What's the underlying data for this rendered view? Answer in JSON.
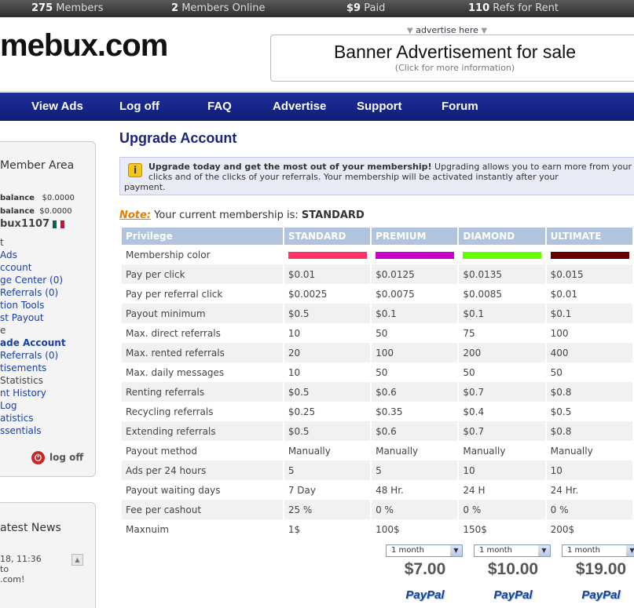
{
  "stats": {
    "members_count": "275",
    "members_label": "Members",
    "online_count": "2",
    "online_label": "Members Online",
    "paid_count": "$9",
    "paid_label": "Paid",
    "refs_count": "110",
    "refs_label": "Refs for Rent"
  },
  "header": {
    "logo": "mebux.com",
    "advertise_link": "advertise here",
    "banner_title": "Banner Advertisement for sale",
    "banner_sub": "(Click for more information)"
  },
  "nav": [
    "View Ads",
    "Log off",
    "FAQ",
    "Advertise",
    "Support",
    "Forum"
  ],
  "sidebar": {
    "title": "Member Area",
    "balance_label": "balance",
    "balance_value": "$0.0000",
    "balance2_label": "balance",
    "balance2_value": "$0.0000",
    "username": "bux1107",
    "items": [
      {
        "label": "t",
        "kind": "plain"
      },
      {
        "label": "Ads",
        "kind": "link"
      },
      {
        "label": "ccount",
        "kind": "link"
      },
      {
        "label": "ge Center (0)",
        "kind": "link"
      },
      {
        "label": " Referrals (0)",
        "kind": "link"
      },
      {
        "label": "tion Tools",
        "kind": "link"
      },
      {
        "label": "st Payout",
        "kind": "link"
      },
      {
        "label": "e",
        "kind": "plain"
      },
      {
        "label": "ade Account",
        "kind": "active"
      },
      {
        "label": "Referrals (0)",
        "kind": "link"
      },
      {
        "label": "tisements",
        "kind": "link"
      },
      {
        "label": " Statistics",
        "kind": "plain"
      },
      {
        "label": "nt History",
        "kind": "link"
      },
      {
        "label": "Log",
        "kind": "link"
      },
      {
        "label": "atistics",
        "kind": "link"
      },
      {
        "label": "ssentials",
        "kind": "link"
      }
    ],
    "logoff": "log off"
  },
  "news": {
    "title": "atest News",
    "date": "18, 11:36",
    "line1": "to",
    "line2": ".com!"
  },
  "main": {
    "title": "Upgrade Account",
    "info_bold": "Upgrade today and get the most out of your membership!",
    "info_text": " Upgrading allows you to earn more from your clicks and of the clicks of your referrals. Your membership will be activated instantly after your",
    "info_cont": "payment.",
    "note_label": "Note:",
    "note_text": " Your current membership is: ",
    "note_value": "STANDARD"
  },
  "table": {
    "headers": [
      "Privilege",
      "STANDARD",
      "PREMIUM",
      "DIAMOND",
      "ULTIMATE"
    ],
    "color_label": "Membership color",
    "colors": [
      "#ff3366",
      "#cc00cc",
      "#66ff00",
      "#660000"
    ],
    "rows": [
      [
        "Pay per click",
        "$0.01",
        "$0.0125",
        "$0.0135",
        "$0.015"
      ],
      [
        "Pay per referral click",
        "$0.0025",
        "$0.0075",
        "$0.0085",
        "$0.01"
      ],
      [
        "Payout minimum",
        "$0.5",
        "$0.1",
        "$0.1",
        "$0.1"
      ],
      [
        "Max. direct referrals",
        "10",
        "50",
        "75",
        "100"
      ],
      [
        "Max. rented referrals",
        "20",
        "100",
        "200",
        "400"
      ],
      [
        "Max. daily messages",
        "10",
        "50",
        "50",
        "50"
      ],
      [
        "Renting referrals",
        "$0.5",
        "$0.6",
        "$0.7",
        "$0.8"
      ],
      [
        "Recycling referrals",
        "$0.25",
        "$0.35",
        "$0.4",
        "$0.5"
      ],
      [
        "Extending referrals",
        "$0.5",
        "$0.6",
        "$0.7",
        "$0.8"
      ],
      [
        "Payout method",
        "Manually",
        "Manually",
        "Manually",
        "Manually"
      ],
      [
        "Ads per 24 hours",
        "5",
        "5",
        "10",
        "10"
      ],
      [
        "Payout waiting days",
        "7 Day",
        "48 Hr.",
        "24 H",
        "24 Hr."
      ],
      [
        "Fee per cashout",
        "25 %",
        "0 %",
        "0 %",
        "0 %"
      ],
      [
        "Maxnuim",
        "1$",
        "100$",
        "150$",
        "200$"
      ]
    ]
  },
  "purchase": {
    "period": "1 month",
    "prices": [
      "$7.00",
      "$10.00",
      "$19.00"
    ],
    "paypal": "PayPal"
  }
}
